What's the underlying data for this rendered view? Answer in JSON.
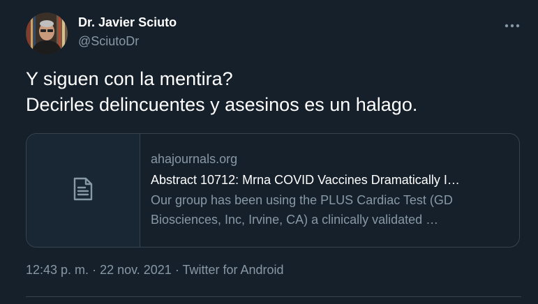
{
  "author": {
    "name": "Dr. Javier Sciuto",
    "handle": "@SciutoDr"
  },
  "menu_icon": "more-horizontal-icon",
  "tweet_text": [
    "Y siguen con la mentira?",
    "Decirles delincuentes y asesinos es un halago."
  ],
  "link_card": {
    "icon": "document-icon",
    "domain": "ahajournals.org",
    "title": "Abstract 10712: Mrna COVID Vaccines Dramatically I…",
    "description": [
      "Our group has been using the PLUS Cardiac Test (GD",
      "Biosciences, Inc, Irvine, CA) a clinically validated …"
    ]
  },
  "meta": {
    "time": "12:43 p. m.",
    "separator": " · ",
    "date": "22 nov. 2021",
    "source": "Twitter for Android"
  },
  "colors": {
    "background": "#15202b",
    "text_primary": "#ffffff",
    "text_secondary": "#8899a6",
    "border": "#38444d"
  }
}
